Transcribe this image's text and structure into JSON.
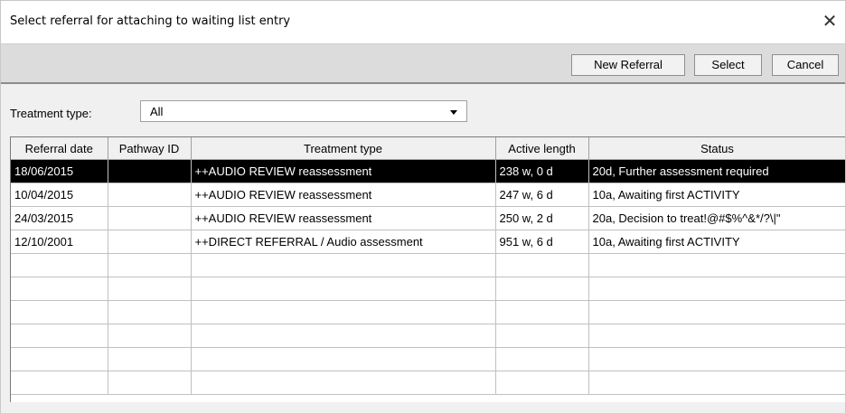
{
  "window": {
    "title": "Select referral for attaching to waiting list entry",
    "close_glyph": "✕"
  },
  "toolbar": {
    "new_referral_label": "New Referral",
    "select_label": "Select",
    "cancel_label": "Cancel"
  },
  "filter": {
    "label": "Treatment type:",
    "value": "All"
  },
  "table": {
    "columns": [
      "Referral date",
      "Pathway ID",
      "Treatment type",
      "Active length",
      "Status"
    ],
    "rows": [
      {
        "date": "18/06/2015",
        "pathway": "",
        "treatment": "++AUDIO REVIEW reassessment",
        "length": "238 w, 0 d",
        "status": "20d, Further assessment required",
        "selected": true
      },
      {
        "date": "10/04/2015",
        "pathway": "",
        "treatment": "++AUDIO REVIEW reassessment",
        "length": "247 w, 6 d",
        "status": "10a, Awaiting first ACTIVITY"
      },
      {
        "date": "24/03/2015",
        "pathway": "",
        "treatment": "++AUDIO REVIEW reassessment",
        "length": "250 w, 2 d",
        "status": "20a, Decision to treat!@#$%^&*/?\\|\""
      },
      {
        "date": "12/10/2001",
        "pathway": "",
        "treatment": "++DIRECT REFERRAL / Audio assessment",
        "length": "951 w, 6 d",
        "status": "10a, Awaiting first ACTIVITY"
      }
    ],
    "selected_row_color": "#000000"
  },
  "colors": {
    "toolbar_bg": "#dcdcdc",
    "window_bg": "#f0f0f0"
  }
}
